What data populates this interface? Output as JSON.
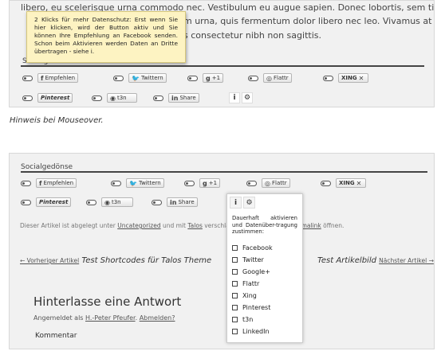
{
  "top_text": {
    "line1": "libero, eu scelerisque urna commodo nec. Vestibulum eu augue sapien. Donec lobortis, sem tincidunt",
    "line2": "m urna, quis fermentum dolor libero nec leo. Vivamus at leo a sem",
    "line3": "s consectetur nibh non sagittis."
  },
  "section_label": "Socialgedönse",
  "buttons": [
    {
      "glyph": "f",
      "label": "Empfehlen"
    },
    {
      "glyph": "🐦",
      "label": "Twittern"
    },
    {
      "glyph": "g",
      "label": "+1"
    },
    {
      "glyph": "◎",
      "label": "Flattr"
    },
    {
      "glyph": "",
      "label": "XING"
    },
    {
      "glyph": "",
      "label": "Pinterest"
    },
    {
      "glyph": "◉",
      "label": "t3n"
    },
    {
      "glyph": "in",
      "label": "Share"
    }
  ],
  "tooltip_text": "2 Klicks für mehr Datenschutz: Erst wenn Sie hier klicken, wird der Button aktiv und Sie können Ihre Empfehlung an Facebook senden. Schon beim Aktivieren werden Daten an Dritte übertragen - siehe i.",
  "caption": "Hinweis bei Mouseover.",
  "info_icon": "i",
  "settings_icon": "⚙",
  "meta": {
    "prefix": "Dieser Artikel ist abgelegt unter ",
    "category": "Uncategorized",
    "middle": " und mit ",
    "tag": "Talos",
    "suffix": " verschlagw",
    "permalink": "Permalink",
    "end": " öffnen."
  },
  "nav": {
    "prev_small": "← Vorheriger Artikel",
    "prev_title": "Test Shortcodes für Talos Theme",
    "next_title": "Test Artikelbild",
    "next_small": "Nächster Artikel →"
  },
  "reply": {
    "title": "Hinterlasse eine Antwort",
    "logged_prefix": "Angemeldet als ",
    "user": "H.-Peter Pfeufer",
    "logout": "Abmelden?",
    "comment_label": "Kommentar"
  },
  "settings_panel": {
    "intro": "Dauerhaft aktivieren und Datenüber-tragung zustimmen:",
    "options": [
      "Facebook",
      "Twitter",
      "Google+",
      "Flattr",
      "Xing",
      "Pinterest",
      "t3n",
      "LinkedIn"
    ]
  }
}
